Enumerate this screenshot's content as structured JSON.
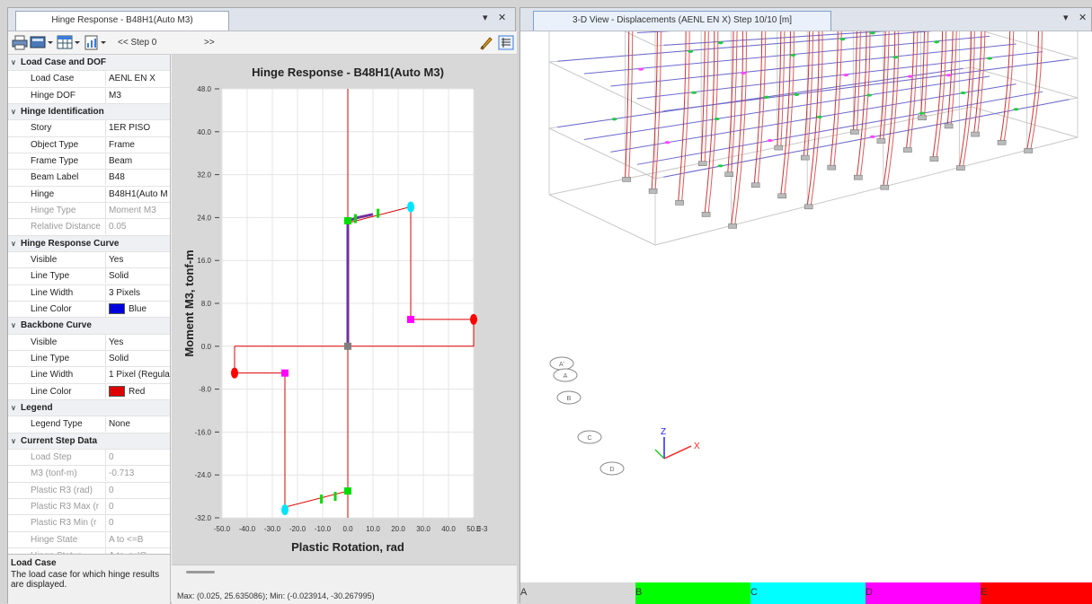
{
  "left_tab": {
    "title": "Hinge Response - B48H1(Auto M3)",
    "pin": "▾",
    "close": "✕"
  },
  "toolbar": {
    "prev_label": "<< Step 0",
    "next_label": ">>"
  },
  "properties": [
    {
      "type": "cat",
      "label": "Load Case and DOF"
    },
    {
      "key": "Load Case",
      "value": "AENL EN X"
    },
    {
      "key": "Hinge DOF",
      "value": "M3"
    },
    {
      "type": "cat",
      "label": "Hinge Identification"
    },
    {
      "key": "Story",
      "value": "1ER PISO"
    },
    {
      "key": "Object Type",
      "value": "Frame"
    },
    {
      "key": "Frame Type",
      "value": "Beam"
    },
    {
      "key": "Beam Label",
      "value": "B48"
    },
    {
      "key": "Hinge",
      "value": "B48H1(Auto M"
    },
    {
      "key": "Hinge Type",
      "value": "Moment M3",
      "dim": true
    },
    {
      "key": "Relative Distance",
      "value": "0.05",
      "dim": true
    },
    {
      "type": "cat",
      "label": "Hinge Response Curve"
    },
    {
      "key": "Visible",
      "value": "Yes"
    },
    {
      "key": "Line Type",
      "value": "Solid"
    },
    {
      "key": "Line Width",
      "value": "3 Pixels"
    },
    {
      "key": "Line Color",
      "value": "Blue",
      "swatch": "#0000dd"
    },
    {
      "type": "cat",
      "label": "Backbone Curve"
    },
    {
      "key": "Visible",
      "value": "Yes"
    },
    {
      "key": "Line Type",
      "value": "Solid"
    },
    {
      "key": "Line Width",
      "value": "1 Pixel (Regula"
    },
    {
      "key": "Line Color",
      "value": "Red",
      "swatch": "#dd0000"
    },
    {
      "type": "cat",
      "label": "Legend"
    },
    {
      "key": "Legend Type",
      "value": "None"
    },
    {
      "type": "cat",
      "label": "Current Step Data"
    },
    {
      "key": "Load Step",
      "value": "0",
      "dim": true
    },
    {
      "key": "M3 (tonf-m)",
      "value": "-0.713",
      "dim": true
    },
    {
      "key": "Plastic R3 (rad)",
      "value": "0",
      "dim": true
    },
    {
      "key": "Plastic R3 Max (r",
      "value": "0",
      "dim": true
    },
    {
      "key": "Plastic R3 Min (r",
      "value": "0",
      "dim": true
    },
    {
      "key": "Hinge State",
      "value": "A to <=B",
      "dim": true
    },
    {
      "key": "Hinge Status",
      "value": "A to <=IO",
      "dim": true
    }
  ],
  "description": {
    "title": "Load Case",
    "text": "The load case for which hinge results are displayed."
  },
  "chart_data": {
    "type": "line",
    "title": "Hinge Response - B48H1(Auto M3)",
    "xlabel": "Plastic Rotation, rad",
    "ylabel": "Moment M3, tonf-m",
    "xunit_suffix": "E-3",
    "xlim": [
      -50,
      50
    ],
    "ylim": [
      -32,
      48
    ],
    "xticks": [
      -50,
      -40,
      -30,
      -20,
      -10,
      0,
      10,
      20,
      30,
      40,
      50
    ],
    "yticks": [
      48,
      40,
      32,
      24,
      16,
      8,
      0,
      -8,
      -16,
      -24,
      -32
    ],
    "grid": true,
    "backbone": {
      "color": "#dd0000",
      "points": [
        [
          -45,
          0
        ],
        [
          -45,
          -5
        ],
        [
          -25,
          -5
        ],
        [
          -25,
          -30
        ],
        [
          0,
          -27
        ],
        [
          0,
          23
        ],
        [
          25,
          26
        ],
        [
          25,
          5
        ],
        [
          50,
          5
        ],
        [
          50,
          0
        ],
        [
          -45,
          0
        ]
      ]
    },
    "response": {
      "color": "#7030a0",
      "points": [
        [
          0,
          0
        ],
        [
          0,
          23.4
        ],
        [
          4,
          24
        ],
        [
          10,
          24.6
        ]
      ]
    },
    "markers": [
      {
        "x": -45,
        "y": -5,
        "color": "#ff0000",
        "shape": "ellipse"
      },
      {
        "x": -25,
        "y": -5,
        "color": "#ff00ff",
        "shape": "square"
      },
      {
        "x": -25,
        "y": -30.5,
        "color": "#00e5ff",
        "shape": "ellipse"
      },
      {
        "x": -10.5,
        "y": -28.5,
        "color": "#00dd00",
        "shape": "tick"
      },
      {
        "x": -5,
        "y": -28,
        "color": "#00dd00",
        "shape": "tick"
      },
      {
        "x": 0,
        "y": -27,
        "color": "#00dd00",
        "shape": "square"
      },
      {
        "x": 0,
        "y": 0,
        "color": "#808080",
        "shape": "square"
      },
      {
        "x": 0,
        "y": 23.4,
        "color": "#00dd00",
        "shape": "square"
      },
      {
        "x": 3,
        "y": 23.8,
        "color": "#00dd00",
        "shape": "tick"
      },
      {
        "x": 12,
        "y": 24.8,
        "color": "#00dd00",
        "shape": "tick"
      },
      {
        "x": 25,
        "y": 26,
        "color": "#00e5ff",
        "shape": "ellipse"
      },
      {
        "x": 25,
        "y": 5,
        "color": "#ff00ff",
        "shape": "square"
      },
      {
        "x": 50,
        "y": 5,
        "color": "#ff0000",
        "shape": "ellipse"
      }
    ]
  },
  "status": {
    "text": "Max: (0.025, 25.635086);  Min: (-0.023914, -30.267995)"
  },
  "right_tab": {
    "title": "3-D View  - Displacements (AENL EN X)  Step 10/10  [m]",
    "pin": "▾",
    "close": "✕"
  },
  "view3d": {
    "axis_labels": {
      "x": "X",
      "z": "Z"
    },
    "grid_bubbles": [
      "A'",
      "A",
      "B",
      "C",
      "D"
    ]
  },
  "legend": [
    {
      "label": "A",
      "color": "#d8d8d8"
    },
    {
      "label": "B",
      "color": "#00ff00"
    },
    {
      "label": "C",
      "color": "#00ffff"
    },
    {
      "label": "D",
      "color": "#ff00ff"
    },
    {
      "label": "E",
      "color": "#ff0000"
    }
  ]
}
